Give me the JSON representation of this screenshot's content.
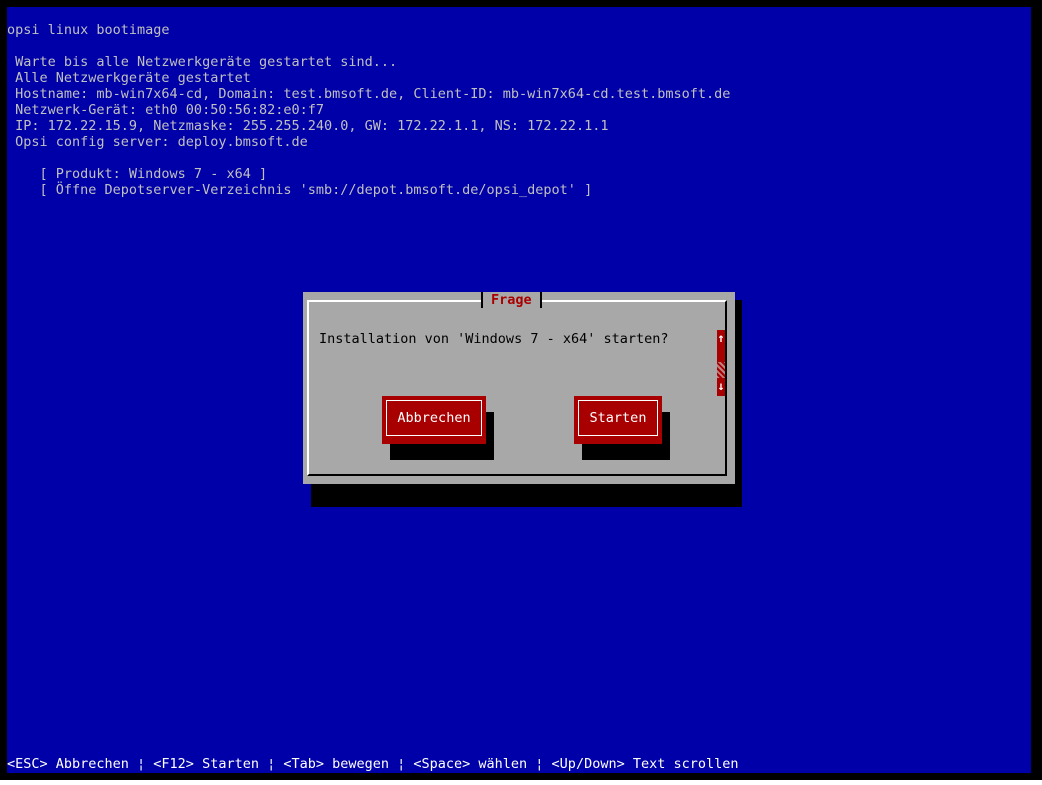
{
  "console": {
    "title": "opsi linux bootimage",
    "log_lines": [
      " Warte bis alle Netzwerkgeräte gestartet sind...",
      " Alle Netzwerkgeräte gestartet",
      " Hostname: mb-win7x64-cd, Domain: test.bmsoft.de, Client-ID: mb-win7x64-cd.test.bmsoft.de",
      " Netzwerk-Gerät: eth0 00:50:56:82:e0:f7",
      " IP: 172.22.15.9, Netzmaske: 255.255.240.0, GW: 172.22.1.1, NS: 172.22.1.1",
      " Opsi config server: deploy.bmsoft.de"
    ],
    "progress_lines": [
      "    [ Produkt: Windows 7 - x64 ]",
      "    [ Öffne Depotserver-Verzeichnis 'smb://depot.bmsoft.de/opsi_depot' ]"
    ]
  },
  "dialog": {
    "title": "Frage",
    "message": "Installation von 'Windows 7 - x64' starten?",
    "cancel_label": "Abbrechen",
    "start_label": "Starten",
    "scroll_up_icon": "↑",
    "scroll_down_icon": "↓"
  },
  "status_bar": {
    "text": "<ESC> Abbrechen ¦ <F12> Starten ¦ <Tab> bewegen ¦ <Space> wählen ¦ <Up/Down> Text scrollen"
  },
  "colors": {
    "background": "#0000a8",
    "dialog": "#a8a8a8",
    "button": "#a80000",
    "title_text": "#a80000"
  }
}
